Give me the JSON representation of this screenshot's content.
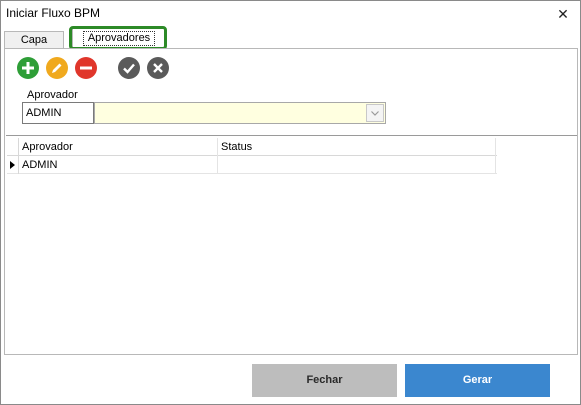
{
  "window": {
    "title": "Iniciar Fluxo BPM",
    "close_icon": "close-icon"
  },
  "tabs": [
    {
      "label": "Capa",
      "selected": false
    },
    {
      "label": "Aprovadores",
      "selected": true
    }
  ],
  "toolbar": {
    "buttons": [
      {
        "icon": "plus-icon",
        "color": "#2e9e37"
      },
      {
        "icon": "pencil-icon",
        "color": "#f0a91e"
      },
      {
        "icon": "minus-icon",
        "color": "#e0362b"
      },
      {
        "icon": "check-icon",
        "color": "#5a5a5a"
      },
      {
        "icon": "x-icon",
        "color": "#5a5a5a"
      }
    ]
  },
  "form": {
    "aprovador_label": "Aprovador",
    "aprovador_code": "ADMIN",
    "aprovador_name": ""
  },
  "grid": {
    "columns": [
      "Aprovador",
      "Status"
    ],
    "rows": [
      {
        "aprovador": "ADMIN",
        "status": ""
      }
    ]
  },
  "footer": {
    "fechar_label": "Fechar",
    "gerar_label": "Gerar"
  },
  "colors": {
    "highlight": "#2d8a27",
    "primary_button": "#3b87cf",
    "secondary_button": "#bdbdbd",
    "combo_background": "#ffffe0"
  }
}
